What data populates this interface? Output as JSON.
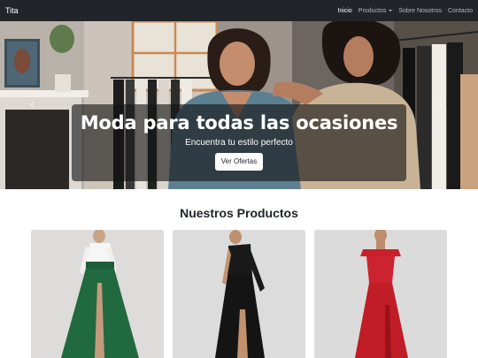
{
  "nav": {
    "brand": "Tita",
    "links": [
      {
        "label": "Inicio",
        "active": true
      },
      {
        "label": "Productos",
        "dropdown": true
      },
      {
        "label": "Sobre Nosotros"
      },
      {
        "label": "Contacto"
      }
    ]
  },
  "hero": {
    "title": "Moda para todas las ocasiones",
    "subtitle": "Encuentra tu estilo perfecto",
    "cta_label": "Ver Ofertas",
    "prev_icon": "chevron-left-icon",
    "next_icon": "chevron-right-icon"
  },
  "products": {
    "title": "Nuestros Productos",
    "items": [
      {
        "name": "white-blouse-green-skirt-gown",
        "color": "#1f6b3f"
      },
      {
        "name": "black-one-shoulder-gown",
        "color": "#161616"
      },
      {
        "name": "red-off-shoulder-gown",
        "color": "#c8202a"
      }
    ]
  },
  "colors": {
    "navbar": "#212529",
    "nav_text": "#b5b8bb",
    "caption_bg": "rgba(20,20,20,0.62)",
    "card_bg": "#d9d9d9"
  }
}
